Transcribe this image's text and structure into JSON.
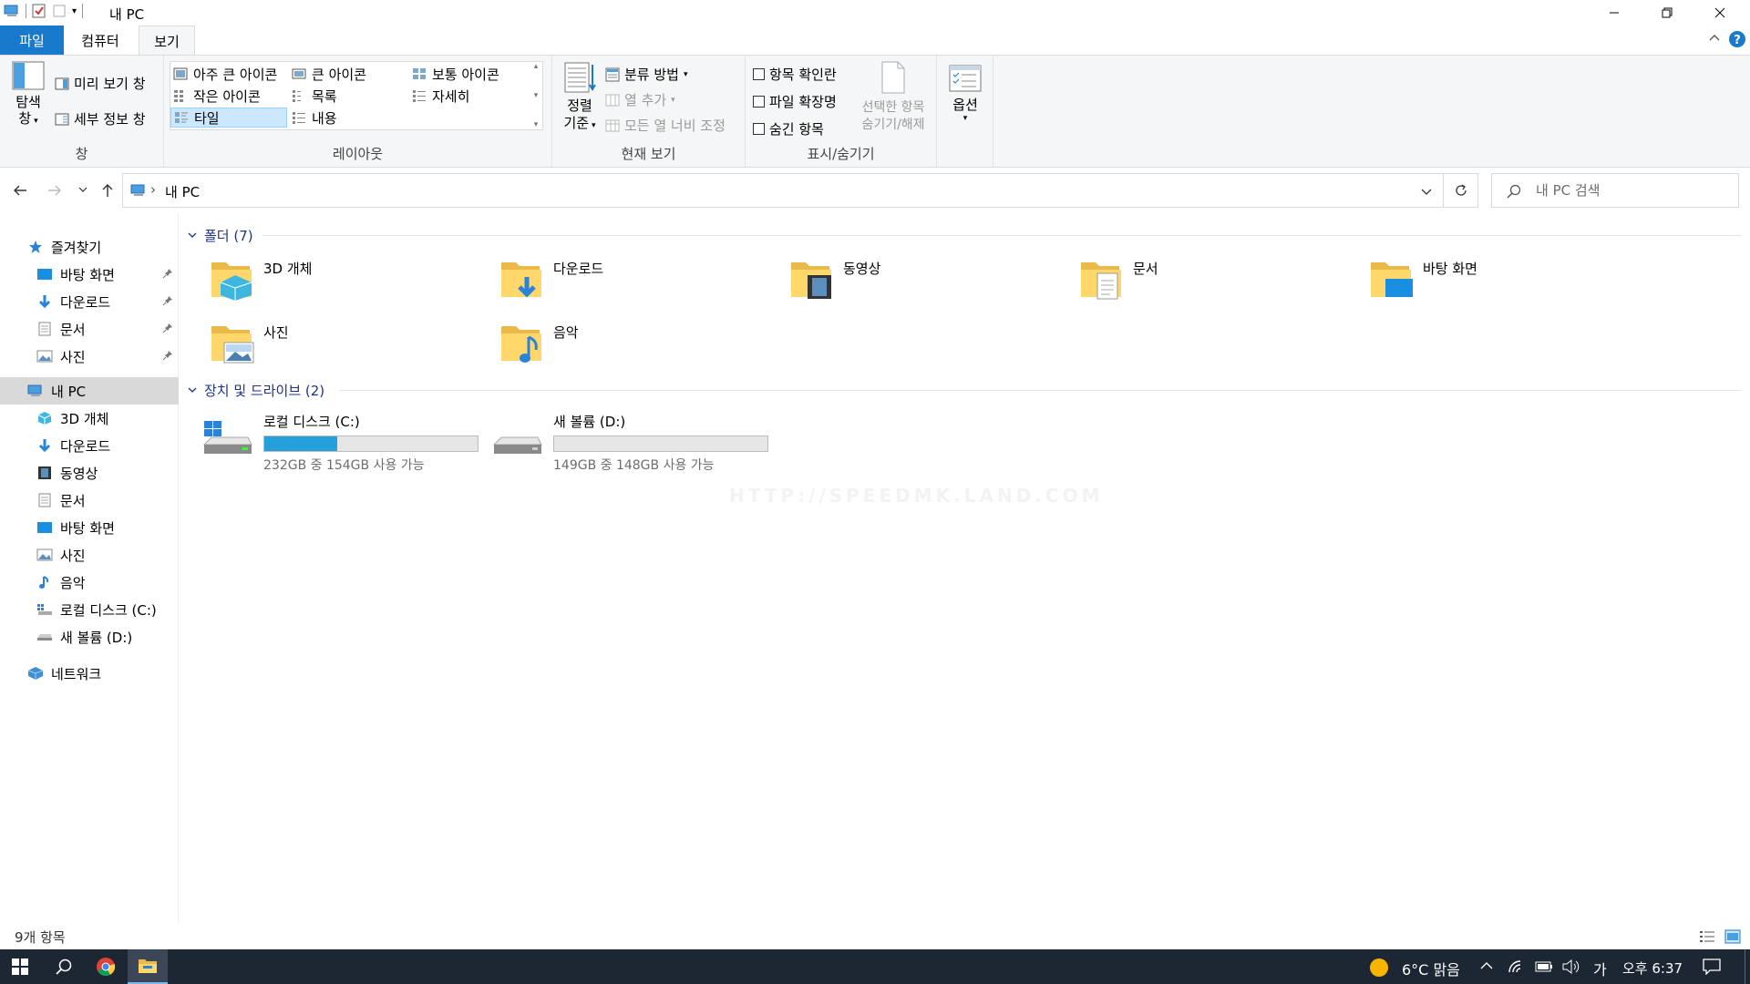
{
  "window": {
    "title": "내 PC",
    "minimize": "minimize",
    "restore": "restore",
    "close": "close"
  },
  "ribbon_tabs": [
    "파일",
    "컴퓨터",
    "보기"
  ],
  "ribbon": {
    "pane_group": {
      "label": "창",
      "nav_pane": "탐색\n창",
      "nav_pane_line1": "탐색",
      "nav_pane_line2": "창",
      "preview_pane": "미리 보기 창",
      "details_pane": "세부 정보 창"
    },
    "layout_group": {
      "label": "레이아웃",
      "items": [
        "아주 큰 아이콘",
        "큰 아이콘",
        "보통 아이콘",
        "작은 아이콘",
        "목록",
        "자세히",
        "타일",
        "내용"
      ],
      "selected": "타일"
    },
    "current_view_group": {
      "label": "현재 보기",
      "sort_line1": "정렬",
      "sort_line2": "기준",
      "group_by": "분류 방법",
      "add_columns": "열 추가",
      "size_columns": "모든 열 너비 조정"
    },
    "show_hide_group": {
      "label": "표시/숨기기",
      "item_checkboxes": "항목 확인란",
      "file_extensions": "파일 확장명",
      "hidden_items": "숨긴 항목",
      "hide_selected_line1": "선택한 항목",
      "hide_selected_line2": "숨기기/해제"
    },
    "options": "옵션"
  },
  "address_bar": {
    "path": "내 PC",
    "separator": "›"
  },
  "search": {
    "placeholder": "내 PC 검색"
  },
  "nav_pane": {
    "quick_access": "즐겨찾기",
    "quick_items": [
      "바탕 화면",
      "다운로드",
      "문서",
      "사진"
    ],
    "this_pc": "내 PC",
    "pc_items": [
      "3D 개체",
      "다운로드",
      "동영상",
      "문서",
      "바탕 화면",
      "사진",
      "음악",
      "로컬 디스크 (C:)",
      "새 볼륨 (D:)"
    ],
    "network": "네트워크"
  },
  "content": {
    "folders_header": "폴더 (7)",
    "folders": [
      "3D 개체",
      "다운로드",
      "동영상",
      "문서",
      "바탕 화면",
      "사진",
      "음악"
    ],
    "drives_header": "장치 및 드라이브 (2)",
    "drives": [
      {
        "name": "로컬 디스크 (C:)",
        "space": "232GB 중 154GB 사용 가능",
        "used_fraction": 0.34
      },
      {
        "name": "새 볼륨 (D:)",
        "space": "149GB 중 148GB 사용 가능",
        "used_fraction": 0.0
      }
    ],
    "watermark": "HTTP://SPEEDMK.LAND.COM"
  },
  "status": {
    "count": "9개 항목"
  },
  "taskbar": {
    "weather": "6°C 맑음",
    "ime": "가",
    "time": "오후 6:37"
  },
  "colors": {
    "accent": "#1979ca",
    "drive_fill": "#26a0da",
    "taskbar": "#1d2633",
    "group_header": "#1e3287",
    "selection": "#cce8ff"
  }
}
